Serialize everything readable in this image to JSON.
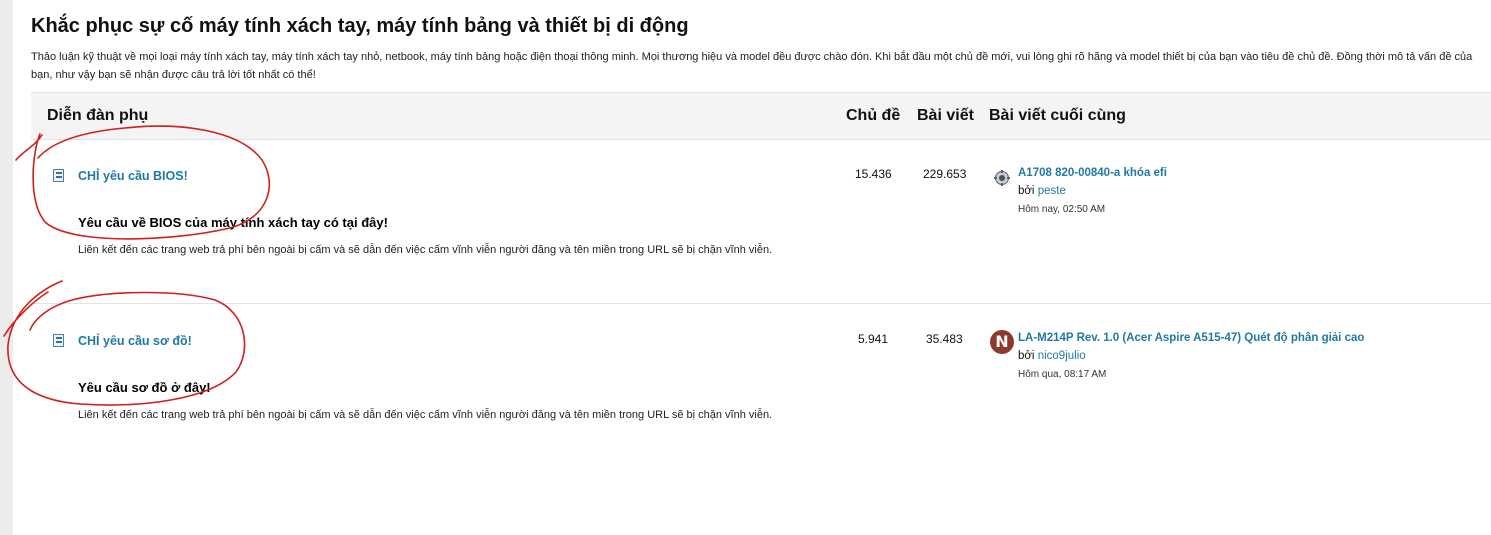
{
  "page": {
    "title": "Khắc phục sự cố máy tính xách tay, máy tính bảng và thiết bị di động",
    "description": "Thảo luận kỹ thuật về mọi loại máy tính xách tay, máy tính xách tay nhỏ, netbook, máy tính bảng hoặc điện thoại thông minh. Mọi thương hiệu và model đều được chào đón. Khi bắt đầu một chủ đề mới, vui lòng ghi rõ hãng và model thiết bị của bạn vào tiêu đề chủ đề. Đồng thời mô tả vấn đề của bạn, như vậy bạn sẽ nhận được câu trả lời tốt nhất có thể!"
  },
  "table": {
    "headers": {
      "subforum": "Diễn đàn phụ",
      "topics": "Chủ đề",
      "posts": "Bài viết",
      "last_post": "Bài viết cuối cùng"
    }
  },
  "forums": [
    {
      "icon": "forum-icon",
      "title": "CHỈ yêu cầu BIOS!",
      "subtitle": "Yêu cầu về BIOS của máy tính xách tay có tại đây!",
      "note": "Liên kết đến các trang web trả phí bên ngoài bị cấm và sẽ dẫn đến việc cấm vĩnh viễn người đăng và tên miền trong URL sẽ bị chặn vĩnh viễn.",
      "topics": "15.436",
      "posts": "229.653",
      "last_post": {
        "avatar": "gear-avatar-icon",
        "title": "A1708 820-00840-a khóa efi",
        "by_label": "bởi",
        "user": "peste",
        "time": "Hôm nay, 02:50 AM"
      }
    },
    {
      "icon": "forum-icon",
      "title": "CHỈ yêu cầu sơ đồ!",
      "subtitle": "Yêu cầu sơ đồ ở đây!",
      "note": "Liên kết đến các trang web trả phí bên ngoài bị cấm và sẽ dẫn đến việc cấm vĩnh viễn người đăng và tên miền trong URL sẽ bị chặn vĩnh viễn.",
      "topics": "5.941",
      "posts": "35.483",
      "last_post": {
        "avatar": "N",
        "title": "LA-M214P Rev. 1.0 (Acer Aspire A515-47) Quét độ phân giải cao",
        "by_label": "bởi",
        "user": "nico9julio",
        "time": "Hôm qua, 08:17 AM"
      }
    }
  ],
  "colors": {
    "link": "#1f7aa3",
    "header_bg": "#f4f4f4",
    "annotation": "#d0201c"
  }
}
